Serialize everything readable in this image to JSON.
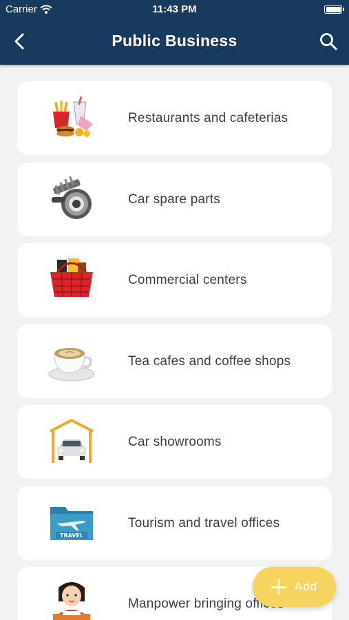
{
  "status_bar": {
    "carrier": "Carrier",
    "time": "11:43 PM"
  },
  "header": {
    "title": "Public Business",
    "back_icon": "chevron-left-icon",
    "search_icon": "search-icon",
    "color": "#173a5e"
  },
  "categories": [
    {
      "label": "Restaurants and cafeterias",
      "icon": "fast-food-icon"
    },
    {
      "label": "Car spare parts",
      "icon": "gear-parts-icon"
    },
    {
      "label": "Commercial centers",
      "icon": "shopping-basket-icon"
    },
    {
      "label": "Tea cafes and coffee shops",
      "icon": "coffee-cup-icon"
    },
    {
      "label": "Car showrooms",
      "icon": "car-showroom-icon"
    },
    {
      "label": "Tourism and travel offices",
      "icon": "travel-folder-icon"
    },
    {
      "label": "Manpower bringing offices",
      "icon": "office-worker-icon"
    }
  ],
  "fab": {
    "label": "Add",
    "icon": "plus-icon",
    "color": "#f7d35f"
  }
}
